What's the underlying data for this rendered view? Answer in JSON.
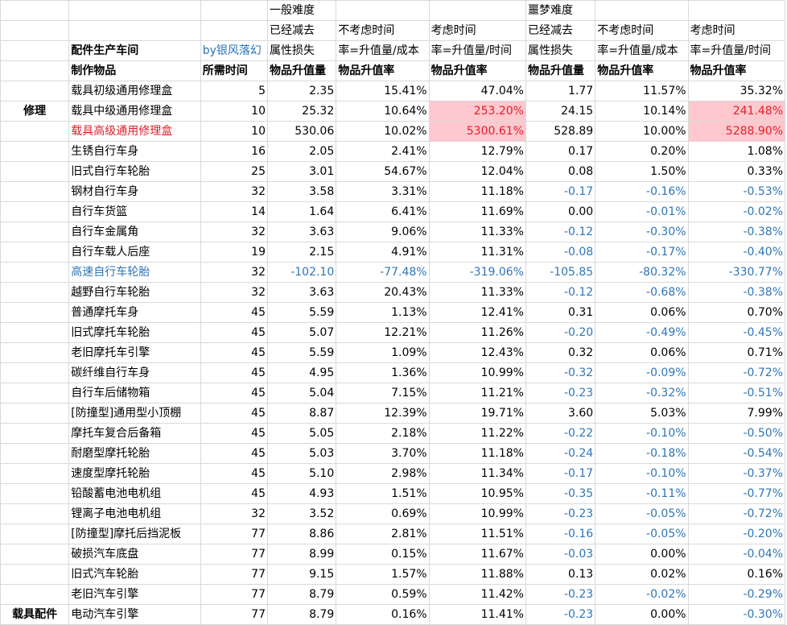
{
  "header": {
    "row1": {
      "normal": "一般难度",
      "nightmare": "噩梦难度"
    },
    "row2": {
      "n_deduct": "已经减去",
      "n_notime": "不考虑时间",
      "n_time": "考虑时间",
      "m_deduct": "已经减去",
      "m_notime": "不考虑时间",
      "m_time": "考虑时间"
    },
    "row3": {
      "workshop": "配件生产车间",
      "author": "by银风落幻",
      "n_deduct": "属性损失",
      "n_notime": "率=升值量/成本",
      "n_time": "率=升值量/时间",
      "m_deduct": "属性损失",
      "m_notime": "率=升值量/成本",
      "m_time": "率=升值量/时间"
    },
    "row4": {
      "item": "制作物品",
      "time": "所需时间",
      "n_val": "物品升值量",
      "n_rate": "物品升值率",
      "n_rate2": "物品升值率",
      "m_val": "物品升值量",
      "m_rate": "物品升值率",
      "m_rate2": "物品升值率"
    }
  },
  "repair": {
    "category": "修理",
    "rows": [
      {
        "name": "载具初级通用修理盒",
        "time": "5",
        "n_val": "2.35",
        "n_rate": "15.41%",
        "n_time": "47.04%",
        "m_val": "1.77",
        "m_rate": "11.57%",
        "m_time": "35.32%"
      },
      {
        "name": "载具中级通用修理盒",
        "time": "10",
        "n_val": "25.32",
        "n_rate": "10.64%",
        "n_time": "253.20%",
        "m_val": "24.15",
        "m_rate": "10.14%",
        "m_time": "241.48%"
      },
      {
        "name": "载具高级通用修理盒",
        "time": "10",
        "n_val": "530.06",
        "n_rate": "10.02%",
        "n_time": "5300.61%",
        "m_val": "528.89",
        "m_rate": "10.00%",
        "m_time": "5288.90%"
      }
    ]
  },
  "parts": {
    "category": "载具配件",
    "rows": [
      {
        "name": "生锈自行车身",
        "time": "16",
        "n_val": "2.05",
        "n_rate": "2.41%",
        "n_time": "12.79%",
        "m_val": "0.17",
        "m_rate": "0.20%",
        "m_time": "1.08%"
      },
      {
        "name": "旧式自行车轮胎",
        "time": "25",
        "n_val": "3.01",
        "n_rate": "54.67%",
        "n_time": "12.04%",
        "m_val": "0.08",
        "m_rate": "1.50%",
        "m_time": "0.33%"
      },
      {
        "name": "钢材自行车身",
        "time": "32",
        "n_val": "3.58",
        "n_rate": "3.31%",
        "n_time": "11.18%",
        "m_val": "-0.17",
        "m_rate": "-0.16%",
        "m_time": "-0.53%"
      },
      {
        "name": "自行车货篮",
        "time": "14",
        "n_val": "1.64",
        "n_rate": "6.41%",
        "n_time": "11.69%",
        "m_val": "0.00",
        "m_rate": "-0.01%",
        "m_time": "-0.02%"
      },
      {
        "name": "自行车金属角",
        "time": "32",
        "n_val": "3.63",
        "n_rate": "9.06%",
        "n_time": "11.33%",
        "m_val": "-0.12",
        "m_rate": "-0.30%",
        "m_time": "-0.38%"
      },
      {
        "name": "自行车载人后座",
        "time": "19",
        "n_val": "2.15",
        "n_rate": "4.91%",
        "n_time": "11.31%",
        "m_val": "-0.08",
        "m_rate": "-0.17%",
        "m_time": "-0.40%"
      },
      {
        "name": "高速自行车轮胎",
        "time": "32",
        "n_val": "-102.10",
        "n_rate": "-77.48%",
        "n_time": "-319.06%",
        "m_val": "-105.85",
        "m_rate": "-80.32%",
        "m_time": "-330.77%"
      },
      {
        "name": "越野自行车轮胎",
        "time": "32",
        "n_val": "3.63",
        "n_rate": "20.43%",
        "n_time": "11.33%",
        "m_val": "-0.12",
        "m_rate": "-0.68%",
        "m_time": "-0.38%"
      },
      {
        "name": "普通摩托车身",
        "time": "45",
        "n_val": "5.59",
        "n_rate": "1.13%",
        "n_time": "12.41%",
        "m_val": "0.31",
        "m_rate": "0.06%",
        "m_time": "0.70%"
      },
      {
        "name": "旧式摩托车轮胎",
        "time": "45",
        "n_val": "5.07",
        "n_rate": "12.21%",
        "n_time": "11.26%",
        "m_val": "-0.20",
        "m_rate": "-0.49%",
        "m_time": "-0.45%"
      },
      {
        "name": "老旧摩托车引擎",
        "time": "45",
        "n_val": "5.59",
        "n_rate": "1.09%",
        "n_time": "12.43%",
        "m_val": "0.32",
        "m_rate": "0.06%",
        "m_time": "0.71%"
      },
      {
        "name": "碳纤维自行车身",
        "time": "45",
        "n_val": "4.95",
        "n_rate": "1.36%",
        "n_time": "10.99%",
        "m_val": "-0.32",
        "m_rate": "-0.09%",
        "m_time": "-0.72%"
      },
      {
        "name": "自行车后储物箱",
        "time": "45",
        "n_val": "5.04",
        "n_rate": "7.15%",
        "n_time": "11.21%",
        "m_val": "-0.23",
        "m_rate": "-0.32%",
        "m_time": "-0.51%"
      },
      {
        "name": "[防撞型]通用型小顶棚",
        "time": "45",
        "n_val": "8.87",
        "n_rate": "12.39%",
        "n_time": "19.71%",
        "m_val": "3.60",
        "m_rate": "5.03%",
        "m_time": "7.99%"
      },
      {
        "name": "摩托车复合后备箱",
        "time": "45",
        "n_val": "5.05",
        "n_rate": "2.18%",
        "n_time": "11.22%",
        "m_val": "-0.22",
        "m_rate": "-0.10%",
        "m_time": "-0.50%"
      },
      {
        "name": "耐磨型摩托轮胎",
        "time": "45",
        "n_val": "5.03",
        "n_rate": "3.70%",
        "n_time": "11.18%",
        "m_val": "-0.24",
        "m_rate": "-0.18%",
        "m_time": "-0.54%"
      },
      {
        "name": "速度型摩托轮胎",
        "time": "45",
        "n_val": "5.10",
        "n_rate": "2.98%",
        "n_time": "11.34%",
        "m_val": "-0.17",
        "m_rate": "-0.10%",
        "m_time": "-0.37%"
      },
      {
        "name": "铅酸蓄电池电机组",
        "time": "45",
        "n_val": "4.93",
        "n_rate": "1.51%",
        "n_time": "10.95%",
        "m_val": "-0.35",
        "m_rate": "-0.11%",
        "m_time": "-0.77%"
      },
      {
        "name": "锂离子电池电机组",
        "time": "32",
        "n_val": "3.52",
        "n_rate": "0.69%",
        "n_time": "10.99%",
        "m_val": "-0.23",
        "m_rate": "-0.05%",
        "m_time": "-0.72%"
      },
      {
        "name": "[防撞型]摩托后挡泥板",
        "time": "77",
        "n_val": "8.86",
        "n_rate": "2.81%",
        "n_time": "11.51%",
        "m_val": "-0.16",
        "m_rate": "-0.05%",
        "m_time": "-0.20%"
      },
      {
        "name": "破损汽车底盘",
        "time": "77",
        "n_val": "8.99",
        "n_rate": "0.15%",
        "n_time": "11.67%",
        "m_val": "-0.03",
        "m_rate": "0.00%",
        "m_time": "-0.04%"
      },
      {
        "name": "旧式汽车轮胎",
        "time": "77",
        "n_val": "9.15",
        "n_rate": "1.57%",
        "n_time": "11.88%",
        "m_val": "0.13",
        "m_rate": "0.02%",
        "m_time": "0.16%"
      },
      {
        "name": "老旧汽车引擎",
        "time": "77",
        "n_val": "8.79",
        "n_rate": "0.59%",
        "n_time": "11.42%",
        "m_val": "-0.23",
        "m_rate": "-0.02%",
        "m_time": "-0.29%"
      },
      {
        "name": "电动汽车引擎",
        "time": "77",
        "n_val": "8.79",
        "n_rate": "0.16%",
        "n_time": "11.41%",
        "m_val": "-0.23",
        "m_rate": "0.00%",
        "m_time": "-0.30%"
      }
    ]
  },
  "colors": {
    "negative": "#2e75b6",
    "highlight_text": "#e0202a",
    "highlight_fill": "#ffc7ce"
  }
}
